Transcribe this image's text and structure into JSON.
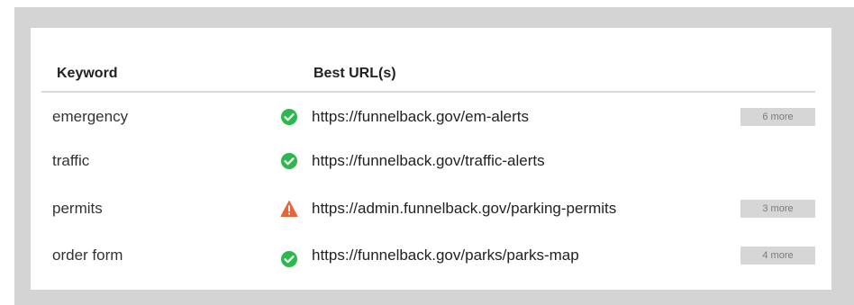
{
  "table": {
    "headers": {
      "keyword": "Keyword",
      "best_urls": "Best URL(s)"
    },
    "rows": [
      {
        "keyword": "emergency",
        "status": "ok",
        "url": "https://funnelback.gov/em-alerts",
        "more": "6 more"
      },
      {
        "keyword": "traffic",
        "status": "ok",
        "url": "https://funnelback.gov/traffic-alerts",
        "more": ""
      },
      {
        "keyword": "permits",
        "status": "warning",
        "url": "https://admin.funnelback.gov/parking-permits",
        "more": "3 more"
      },
      {
        "keyword": "order form",
        "status": "ok",
        "url": "https://funnelback.gov/parks/parks-map",
        "more": "4 more"
      }
    ]
  },
  "icons": {
    "ok": "check-circle-icon",
    "warning": "warning-triangle-icon"
  },
  "colors": {
    "ok": "#2db84d",
    "warning": "#e8643a",
    "frame": "#d4d4d4",
    "more_button_bg": "#d6d6d6"
  }
}
